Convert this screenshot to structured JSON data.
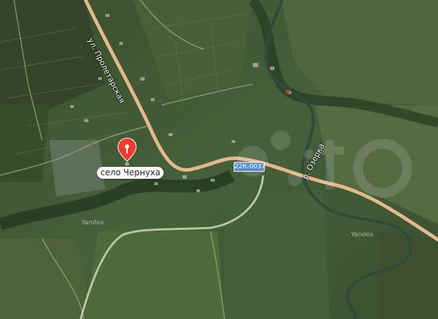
{
  "map": {
    "place_label": "село Чернуха",
    "street_label": "ул. Пролетарская",
    "river_label": "р. Озерка",
    "route_badge": "22К-0037",
    "watermark": "Yandex",
    "marker_icon": "map-pin-icon",
    "colors": {
      "marker": "#ef3b2c",
      "road": "#e3b88c",
      "route_badge": "#5b8ec9",
      "vegetation": "#3f5631"
    }
  }
}
